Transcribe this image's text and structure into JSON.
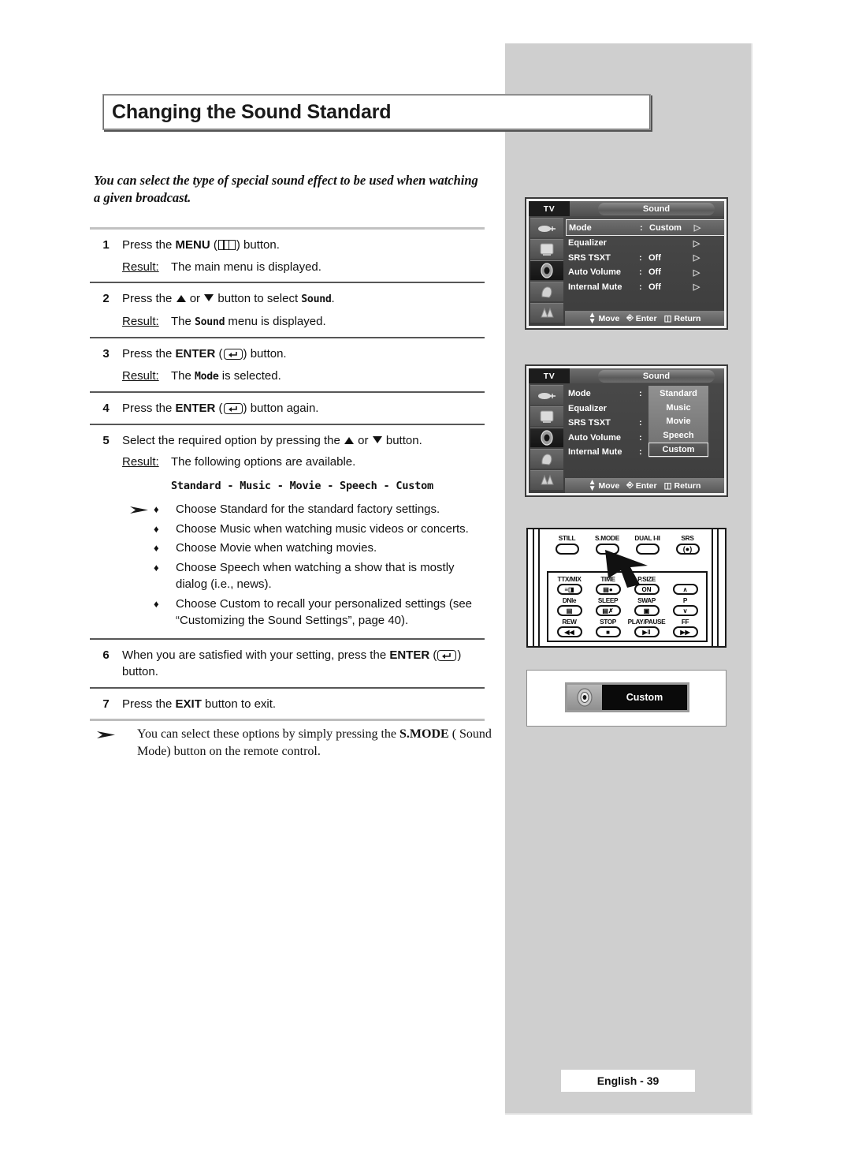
{
  "title": "Changing the Sound Standard",
  "intro": "You can select the type of special sound effect to be used when watching a given broadcast.",
  "result_label": "Result:",
  "steps": [
    {
      "num": "1",
      "pre": "Press the ",
      "bold": "MENU",
      "icon": "menu-icon",
      "post": " button.",
      "result": "The main menu is displayed."
    },
    {
      "num": "2",
      "pre": "Press the ",
      "mid": " or ",
      "post": " button to select ",
      "mono": "Sound",
      "tail": ".",
      "result_pre": "The ",
      "result_mono": "Sound",
      "result_post": " menu is displayed."
    },
    {
      "num": "3",
      "pre": "Press the ",
      "bold": "ENTER",
      "icon": "enter-icon",
      "post": " button.",
      "result_pre": "The ",
      "result_mono": "Mode",
      "result_post": " is selected."
    },
    {
      "num": "4",
      "pre": "Press the ",
      "bold": "ENTER",
      "icon": "enter-icon",
      "post": " button again."
    },
    {
      "num": "5",
      "pre": "Select the required option by pressing the ",
      "mid": " or ",
      "post": " button.",
      "result": "The following options are available.",
      "options": "Standard - Music - Movie - Speech - Custom"
    },
    {
      "num": "6",
      "pre": "When you are satisfied with your setting, press the ",
      "bold": "ENTER",
      "icon": "enter-icon",
      "post": " button."
    },
    {
      "num": "7",
      "pre": "Press the ",
      "bold": "EXIT",
      "post": " button to exit."
    }
  ],
  "bullets": [
    "Choose Standard for the standard factory settings.",
    "Choose Music when watching music videos or concerts.",
    "Choose Movie when watching movies.",
    "Choose Speech when watching a show that is mostly dialog (i.e., news).",
    "Choose Custom to recall your personalized settings (see “Customizing the Sound Settings”, page 40)."
  ],
  "bullet_char": "♦",
  "note": {
    "pre": "You can select these options by simply pressing the ",
    "bold": "S.MODE",
    "post": " ( Sound Mode) button on the remote control."
  },
  "tv_menu_1": {
    "tag": "TV",
    "title": "Sound",
    "rows": [
      {
        "label": "Mode",
        "colon": ":",
        "value": "Custom",
        "arrow": "▷",
        "highlighted": true
      },
      {
        "label": "Equalizer",
        "colon": "",
        "value": "",
        "arrow": "▷",
        "highlighted": false
      },
      {
        "label": "SRS TSXT",
        "colon": ":",
        "value": "Off",
        "arrow": "▷",
        "highlighted": false
      },
      {
        "label": "Auto Volume",
        "colon": ":",
        "value": "Off",
        "arrow": "▷",
        "highlighted": false
      },
      {
        "label": "Internal Mute",
        "colon": ":",
        "value": "Off",
        "arrow": "▷",
        "highlighted": false
      }
    ],
    "footer": {
      "move": "Move",
      "enter": "Enter",
      "return": "Return"
    }
  },
  "tv_menu_2": {
    "tag": "TV",
    "title": "Sound",
    "rows": [
      {
        "label": "Mode",
        "colon": ":"
      },
      {
        "label": "Equalizer",
        "colon": ""
      },
      {
        "label": "SRS TSXT",
        "colon": ":"
      },
      {
        "label": "Auto Volume",
        "colon": ":"
      },
      {
        "label": "Internal Mute",
        "colon": ":"
      }
    ],
    "options": [
      {
        "label": "Standard",
        "selected": false
      },
      {
        "label": "Music",
        "selected": false
      },
      {
        "label": "Movie",
        "selected": false
      },
      {
        "label": "Speech",
        "selected": false
      },
      {
        "label": "Custom",
        "selected": true
      }
    ],
    "footer": {
      "move": "Move",
      "enter": "Enter",
      "return": "Return"
    }
  },
  "remote": {
    "top_keys": [
      {
        "label": "STILL",
        "glyph": ""
      },
      {
        "label": "S.MODE",
        "glyph": ""
      },
      {
        "label": "DUAL I-II",
        "glyph": ""
      },
      {
        "label": "SRS",
        "glyph": "(●)"
      }
    ],
    "grid_keys": [
      {
        "label": "TTX/MIX",
        "glyph": "≡◨"
      },
      {
        "label": "TIME",
        "glyph": "▤●"
      },
      {
        "label": "P.SIZE",
        "glyph": "ON"
      },
      {
        "label": "",
        "glyph": "∧"
      },
      {
        "label": "DNIe",
        "glyph": "▤"
      },
      {
        "label": "SLEEP",
        "glyph": "▤✗"
      },
      {
        "label": "SWAP",
        "glyph": "▣"
      },
      {
        "label": "P",
        "glyph": "∨"
      },
      {
        "label": "REW",
        "glyph": "◀◀"
      },
      {
        "label": "STOP",
        "glyph": "■"
      },
      {
        "label": "PLAY/PAUSE",
        "glyph": "▶‖"
      },
      {
        "label": "FF",
        "glyph": "▶▶"
      }
    ]
  },
  "osd": {
    "label": "Custom",
    "icon": "speaker-icon"
  },
  "footer": "English - 39",
  "colors": {
    "panel_gray": "#cfcfcf",
    "ink": "#111111",
    "rule": "#575757"
  }
}
